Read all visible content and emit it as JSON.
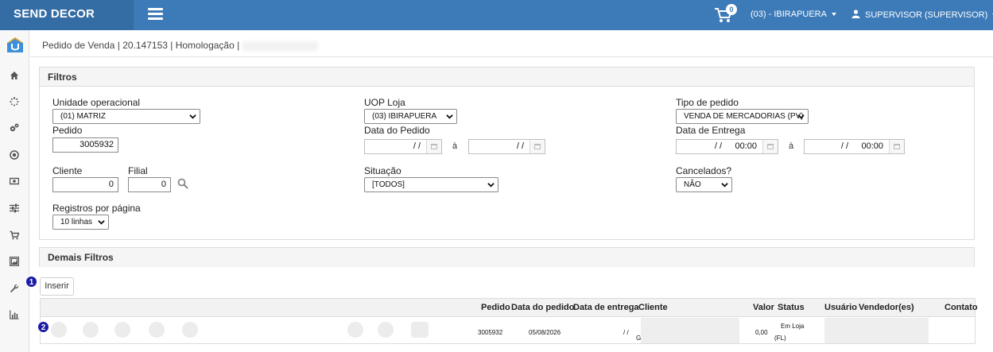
{
  "header": {
    "brand": "SEND DECOR",
    "cart_count": "0",
    "store": "(03) - IBIRAPUERA",
    "user": "SUPERVISOR (SUPERVISOR)",
    "colors": {
      "bar": "#3c7ab8",
      "brand_bg": "#346ca4"
    }
  },
  "sidebar": {
    "icons": [
      "home-icon",
      "spinner-icon",
      "cogs-icon",
      "target-icon",
      "money-icon",
      "sliders-icon",
      "cart-icon",
      "image-icon",
      "wrench-icon",
      "chart-icon"
    ]
  },
  "breadcrumb": "Pedido de Venda | 20.147153 | Homologação |",
  "filters": {
    "title": "Filtros",
    "unidade_label": "Unidade operacional",
    "unidade_value": "(01) MATRIZ",
    "uop_label": "UOP Loja",
    "uop_value": "(03) IBIRAPUERA",
    "tipo_label": "Tipo de pedido",
    "tipo_value": "VENDA DE MERCADORIAS (PV)",
    "pedido_label": "Pedido",
    "pedido_value": "3005932",
    "data_pedido_label": "Data do Pedido",
    "data_pedido_from": "/ /",
    "data_pedido_to": "/ /",
    "data_entrega_label": "Data de Entrega",
    "data_entrega_from_date": "/ /",
    "data_entrega_from_time": "00:00",
    "data_entrega_to_date": "/ /",
    "data_entrega_to_time": "00:00",
    "range_sep": "à",
    "cliente_label": "Cliente",
    "cliente_value": "0",
    "filial_label": "Filial",
    "filial_value": "0",
    "situacao_label": "Situação",
    "situacao_value": "[TODOS]",
    "cancelados_label": "Cancelados?",
    "cancelados_value": "NÃO",
    "registros_label": "Registros por página",
    "registros_value": "10 linhas"
  },
  "demais": {
    "title": "Demais Filtros"
  },
  "inserir_label": "Inserir",
  "steps": [
    "1",
    "2"
  ],
  "table": {
    "columns": [
      "Pedido",
      "Data do pedido",
      "Data de entrega",
      "Cliente",
      "Valor",
      "Status",
      "Usuário",
      "Vendedor(es)",
      "Contato"
    ],
    "row": {
      "pedido": "3005932",
      "data_pedido": "05/08/2026",
      "data_entrega": "/ /",
      "cliente_prefix": "G",
      "valor": "0,00",
      "status_line1": "Em Loja",
      "status_line2": "(FL)"
    }
  }
}
